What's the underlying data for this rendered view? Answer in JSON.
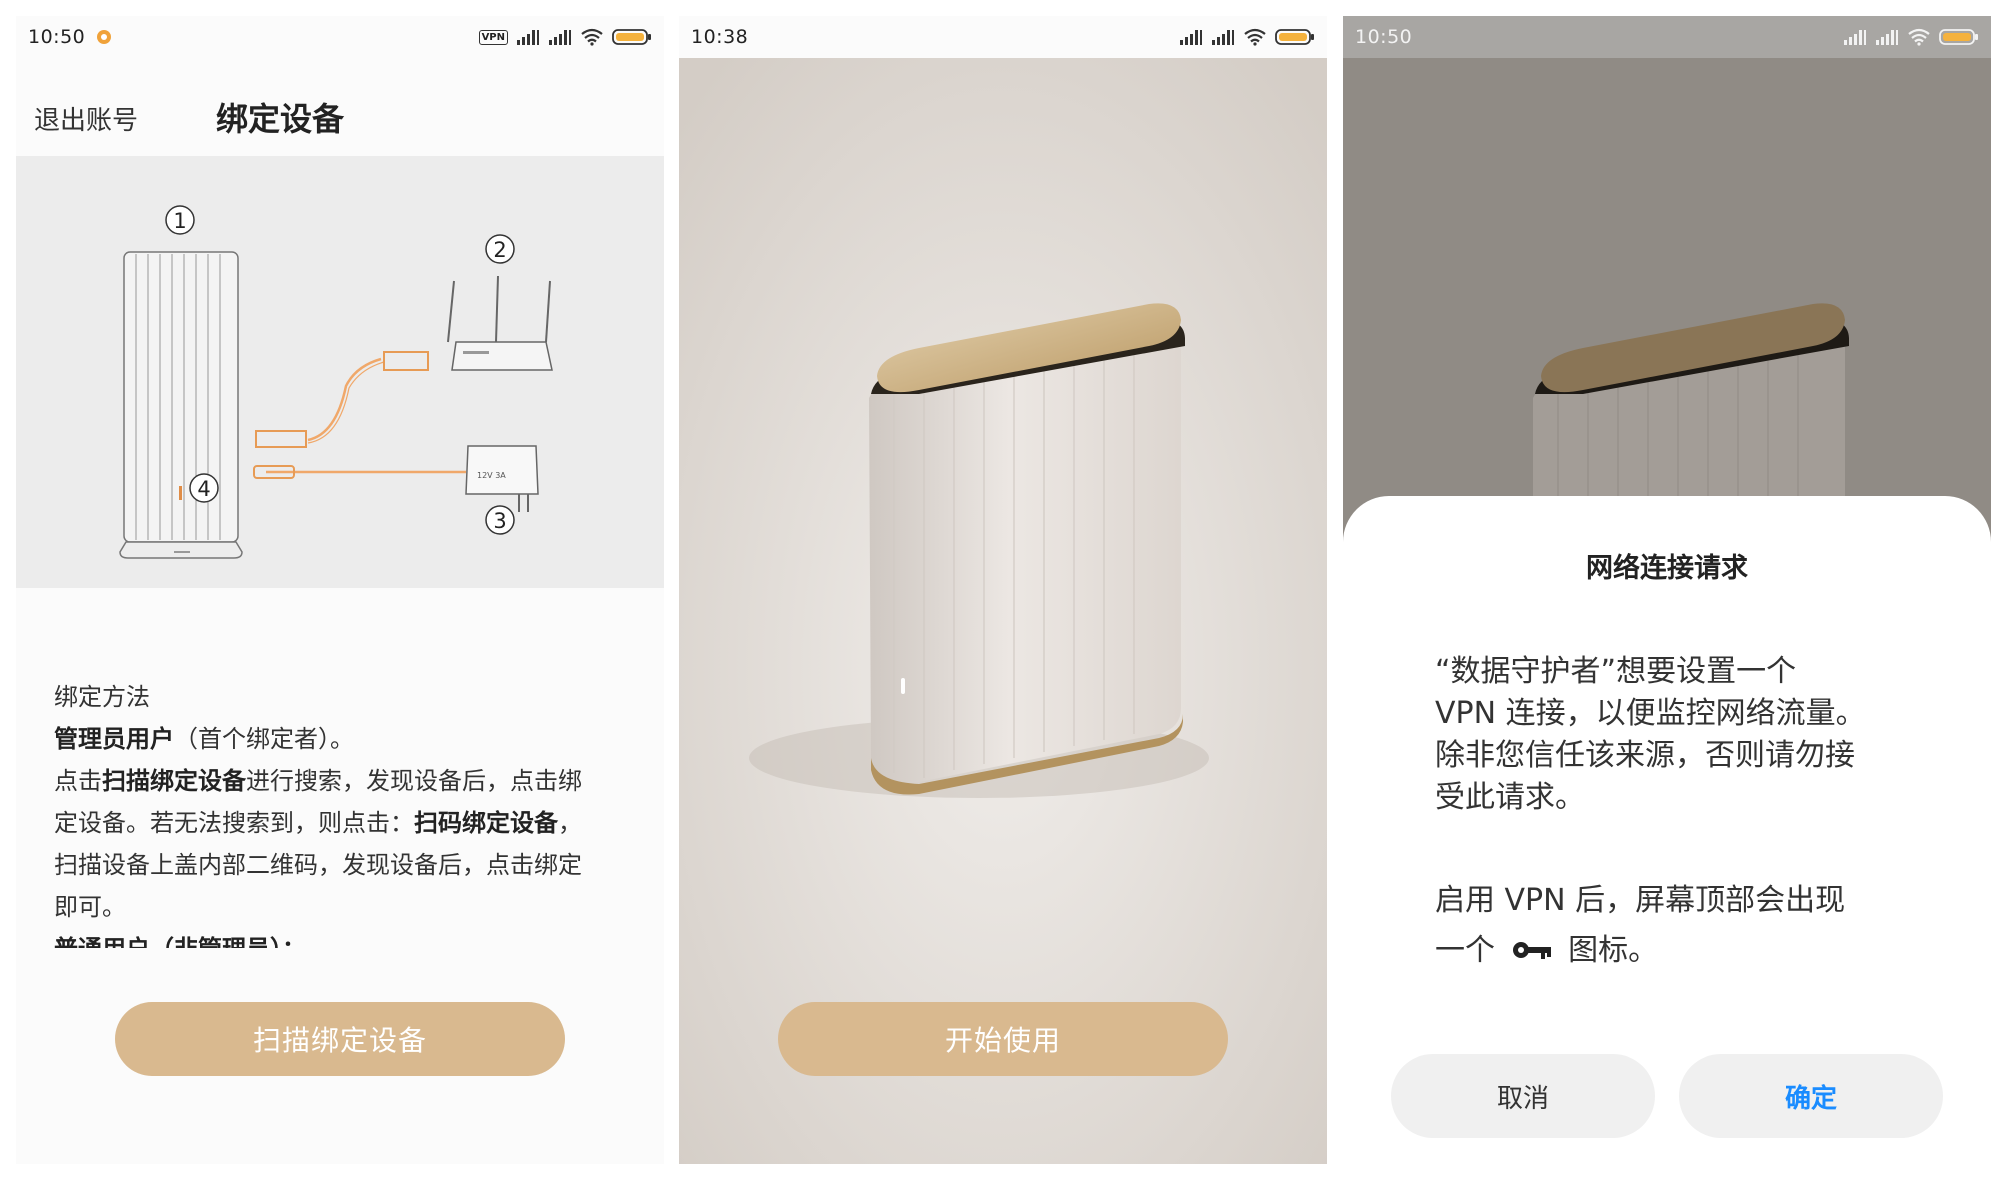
{
  "screen1": {
    "status": {
      "time": "10:50",
      "vpn": "VPN"
    },
    "header": {
      "logout": "退出账号",
      "title": "绑定设备"
    },
    "diagram": {
      "n1": "1",
      "n2": "2",
      "n3": "3",
      "n4": "4",
      "adapter": "12V 3A"
    },
    "instructions": {
      "heading": "绑定方法",
      "admin_label": "管理员用户",
      "admin_note": "（首个绑定者）。",
      "p1_a": "点击",
      "p1_b": "扫描绑定设备",
      "p1_c": "进行搜索，发现设备后，点击绑",
      "p2_a": "定设备。若无法搜索到，则点击：",
      "p2_b": "扫码绑定设备",
      "p2_c": "，",
      "p3": "扫描设备上盖内部二维码，发现设备后，点击绑定",
      "p4": "即可。",
      "p5": "普通用户（非管理员）："
    },
    "button": "扫描绑定设备"
  },
  "screen2": {
    "status": {
      "time": "10:38"
    },
    "button": "开始使用"
  },
  "screen3": {
    "status": {
      "time": "10:50"
    },
    "dialog": {
      "title": "网络连接请求",
      "body_1": "“数据守护者”想要设置一个",
      "body_2": "VPN 连接，以便监控网络流量。",
      "body_3": "除非您信任该来源，否则请勿接",
      "body_4": "受此请求。",
      "body_5": "启用 VPN 后，屏幕顶部会出现",
      "body_6a": "一个",
      "body_6b": "图标。",
      "cancel": "取消",
      "ok": "确定"
    }
  },
  "colors": {
    "accent": "#d9b98f",
    "link": "#1a8cff",
    "orange": "#f0a23a"
  }
}
